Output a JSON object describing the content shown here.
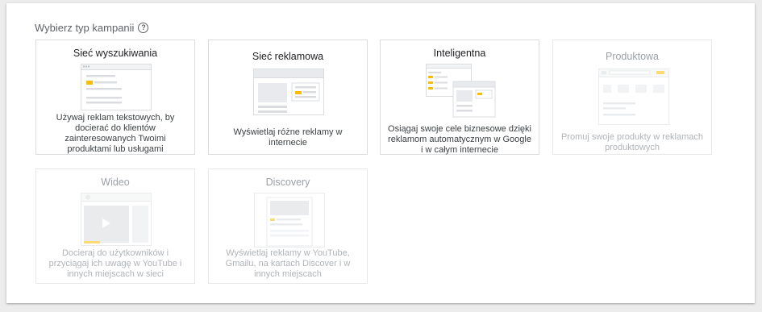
{
  "header": {
    "title": "Wybierz typ kampanii",
    "help_icon": "?"
  },
  "cards": [
    {
      "title": "Sieć wyszukiwania",
      "description": "Używaj reklam tekstowych, by docierać do klientów zainteresowanych Twoimi produktami lub usługami",
      "enabled": true,
      "icon": "search-network-illustration"
    },
    {
      "title": "Sieć reklamowa",
      "description": "Wyświetlaj różne reklamy w internecie",
      "enabled": true,
      "icon": "display-network-illustration"
    },
    {
      "title": "Inteligentna",
      "description": "Osiągaj swoje cele biznesowe dzięki reklamom automatycznym w Google i w całym internecie",
      "enabled": true,
      "icon": "smart-illustration"
    },
    {
      "title": "Produktowa",
      "description": "Promuj swoje produkty w reklamach produktowych",
      "enabled": false,
      "icon": "shopping-illustration"
    },
    {
      "title": "Wideo",
      "description": "Docieraj do użytkowników i przyciągaj ich uwagę w YouTube i innych miejscach w sieci",
      "enabled": false,
      "icon": "video-illustration"
    },
    {
      "title": "Discovery",
      "description": "Wyświetlaj reklamy w YouTube, Gmailu, na kartach Discover i w innych miejscach",
      "enabled": false,
      "icon": "discovery-illustration"
    }
  ],
  "colors": {
    "accent_yellow": "#fbbc04",
    "illustration_grey": "#dadce0",
    "text_primary": "#202124",
    "text_disabled": "#9aa0a6"
  }
}
